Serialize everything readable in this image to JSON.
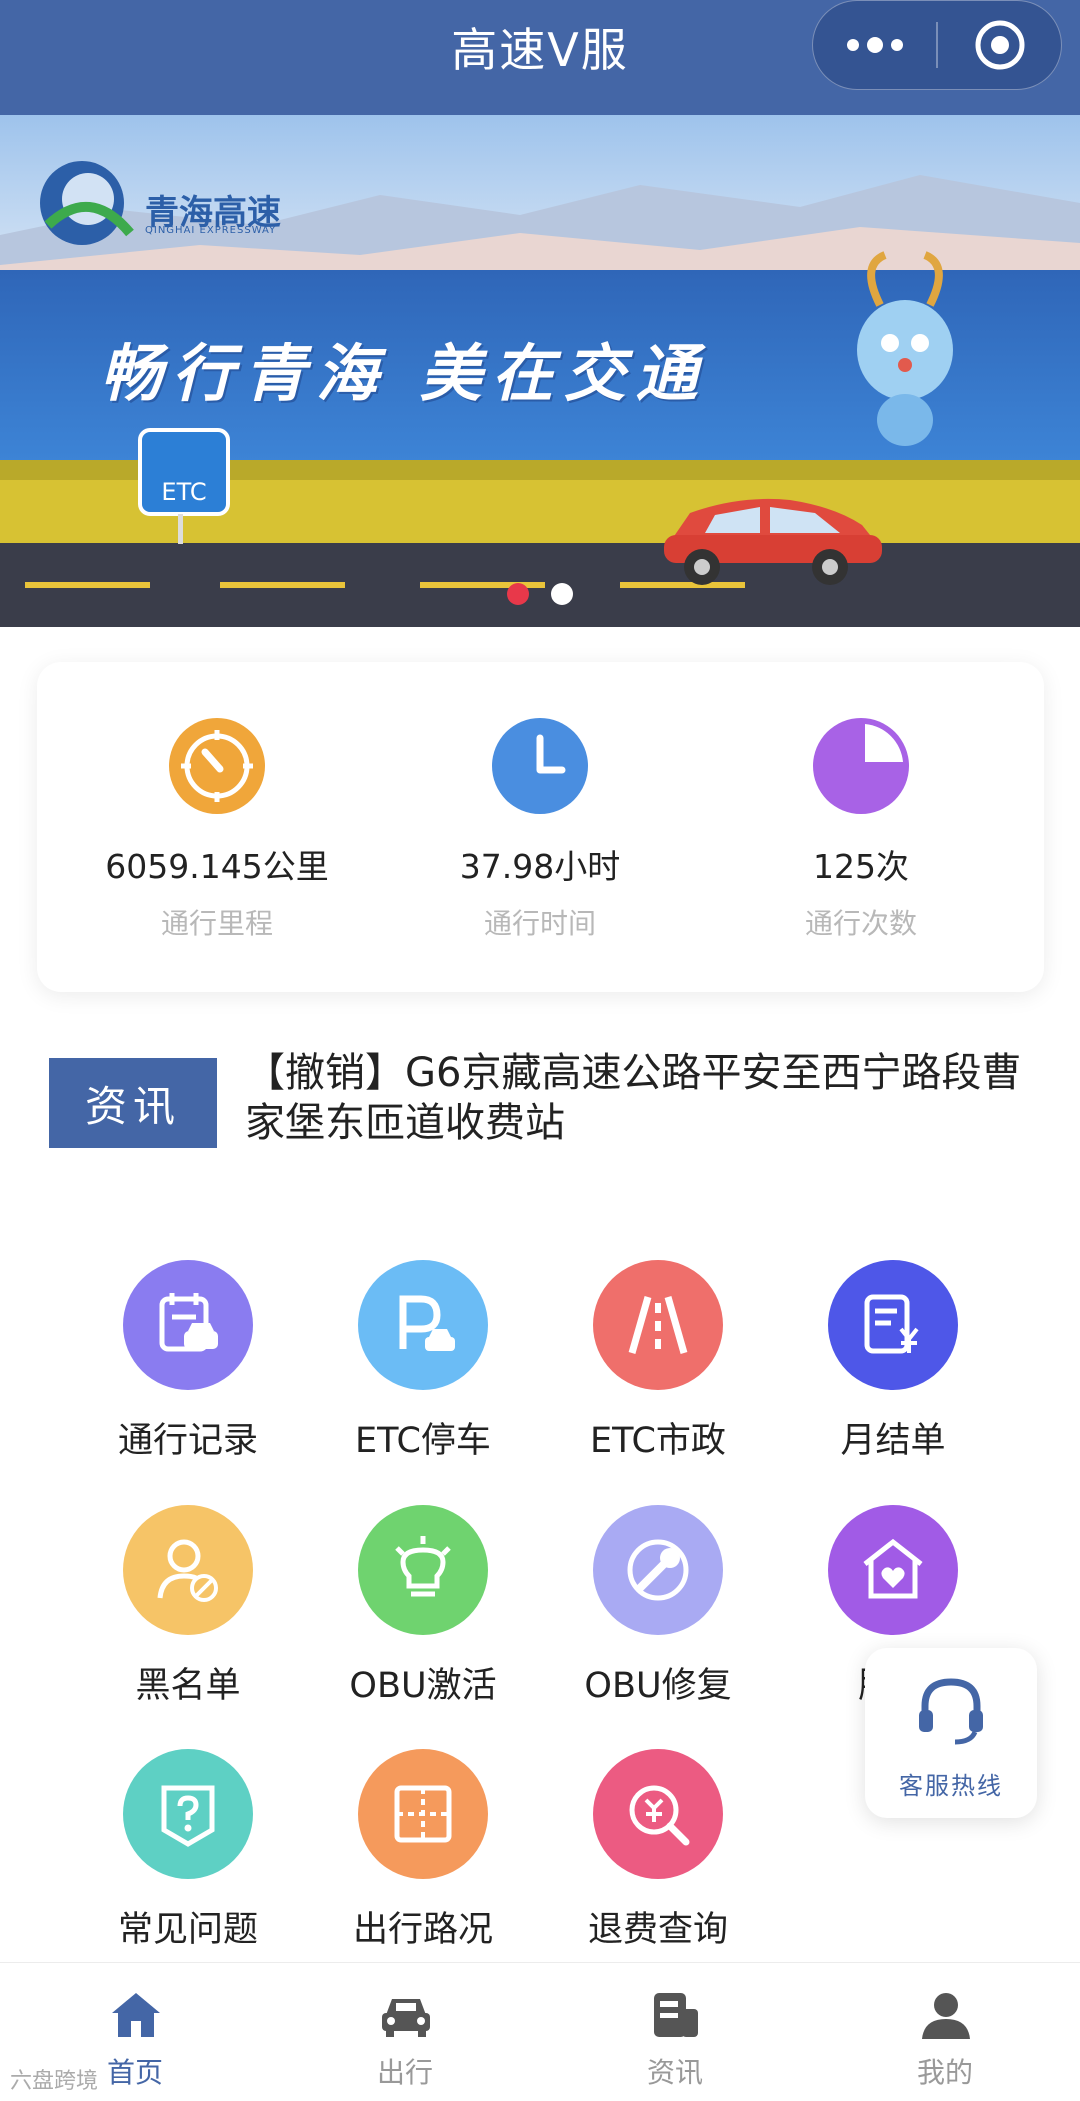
{
  "header": {
    "title": "高速V服"
  },
  "banner": {
    "brand_cn": "青海高速",
    "brand_en": "QINGHAI EXPRESSWAY",
    "slogan": "畅行青海 美在交通",
    "etc_sign": "ETC",
    "slides": 2,
    "active_slide": 1
  },
  "stats": [
    {
      "value": "6059.145公里",
      "label": "通行里程",
      "icon": "speedometer-icon",
      "color": "#f0a63a"
    },
    {
      "value": "37.98小时",
      "label": "通行时间",
      "icon": "clock-icon",
      "color": "#4a8ee0"
    },
    {
      "value": "125次",
      "label": "通行次数",
      "icon": "pie-icon",
      "color": "#a862e6"
    }
  ],
  "news": {
    "badge": "资讯",
    "headline": "【撤销】G6京藏高速公路平安至西宁路段曹家堡东匝道收费站"
  },
  "services": [
    {
      "label": "通行记录",
      "icon": "traffic-record-icon",
      "color": "#8a7cf0"
    },
    {
      "label": "ETC停车",
      "icon": "etc-parking-icon",
      "color": "#6bbcf5"
    },
    {
      "label": "ETC市政",
      "icon": "etc-municipal-icon",
      "color": "#ef6f6b"
    },
    {
      "label": "月结单",
      "icon": "monthly-statement-icon",
      "color": "#4e57e8"
    },
    {
      "label": "黑名单",
      "icon": "blacklist-icon",
      "color": "#f6c467"
    },
    {
      "label": "OBU激活",
      "icon": "obu-activate-icon",
      "color": "#6fd36f"
    },
    {
      "label": "OBU修复",
      "icon": "obu-repair-icon",
      "color": "#a9aaf3"
    },
    {
      "label": "服务",
      "icon": "service-icon",
      "color": "#a15be6"
    },
    {
      "label": "常见问题",
      "icon": "faq-icon",
      "color": "#5ed0c4"
    },
    {
      "label": "出行路况",
      "icon": "road-condition-icon",
      "color": "#f59a5c"
    },
    {
      "label": "退费查询",
      "icon": "refund-query-icon",
      "color": "#ec5b82"
    }
  ],
  "hotline": {
    "label": "客服热线"
  },
  "tabbar": [
    {
      "label": "首页",
      "icon": "home-icon",
      "active": true
    },
    {
      "label": "出行",
      "icon": "car-icon",
      "active": false
    },
    {
      "label": "资讯",
      "icon": "news-icon",
      "active": false
    },
    {
      "label": "我的",
      "icon": "user-icon",
      "active": false
    }
  ],
  "watermark": "六盘跨境",
  "colors": {
    "primary": "#4466a6",
    "dot_active": "#e8384a"
  }
}
